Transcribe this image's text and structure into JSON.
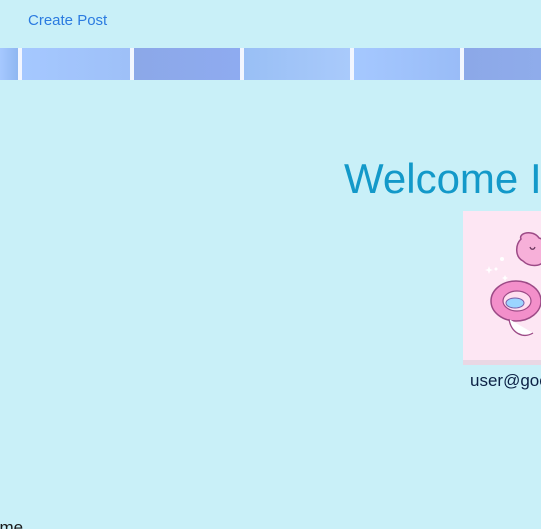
{
  "nav": {
    "create_post_label": "Create Post"
  },
  "header": {
    "welcome_text": "Welcome I"
  },
  "profile": {
    "email": "user@goo"
  },
  "footer": {
    "text": "ome"
  },
  "colors": {
    "background": "#c9f0f8",
    "link": "#2b7be0",
    "welcome": "#1399c9",
    "email": "#0c2145"
  }
}
